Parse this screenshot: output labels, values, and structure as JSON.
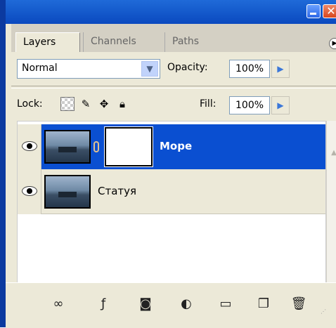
{
  "panel": {
    "tabs": [
      {
        "label": "Layers",
        "active": true
      },
      {
        "label": "Channels",
        "active": false
      },
      {
        "label": "Paths",
        "active": false
      }
    ],
    "blend_mode": "Normal",
    "opacity_label": "Opacity:",
    "opacity_value": "100%",
    "lock_label": "Lock:",
    "fill_label": "Fill:",
    "fill_value": "100%"
  },
  "layers": [
    {
      "name": "Море",
      "selected": true,
      "visible": true,
      "has_mask": true,
      "linked": true
    },
    {
      "name": "Статуя",
      "selected": false,
      "visible": true,
      "has_mask": false,
      "linked": false
    }
  ],
  "toolbar": {
    "icons": [
      "link-layers-icon",
      "layer-style-icon",
      "add-mask-icon",
      "adjustment-layer-icon",
      "new-group-icon",
      "new-layer-icon",
      "delete-layer-icon"
    ]
  },
  "colors": {
    "selected_row": "#0a4fd1",
    "title_blue": "#0a49bf",
    "panel_bg": "#ece9d8"
  }
}
